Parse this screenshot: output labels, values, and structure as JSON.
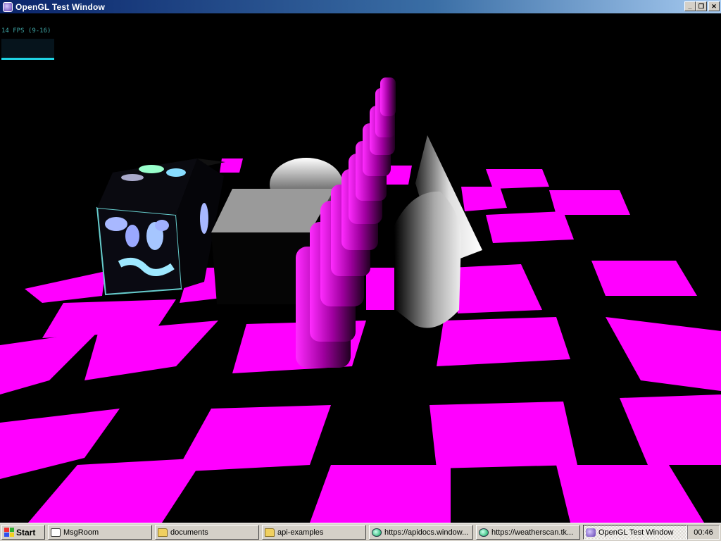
{
  "window": {
    "title": "OpenGL Test Window",
    "minimize_label": "_",
    "restore_label": "❐",
    "close_label": "✕"
  },
  "hud": {
    "fps_text": "14 FPS (9-16)"
  },
  "scene": {
    "floor_color": "#ff00ff",
    "background_color": "#000000"
  },
  "taskbar": {
    "start_label": "Start",
    "tasks": [
      {
        "label": "MsgRoom",
        "icon": "chat-icon"
      },
      {
        "label": "documents",
        "icon": "folder-icon"
      },
      {
        "label": "api-examples",
        "icon": "folder-icon"
      },
      {
        "label": "https://apidocs.window...",
        "icon": "browser-icon"
      },
      {
        "label": "https://weatherscan.tk...",
        "icon": "browser-icon"
      },
      {
        "label": "OpenGL Test Window",
        "icon": "opengl-app-icon",
        "active": true
      }
    ],
    "clock": "00:46"
  }
}
